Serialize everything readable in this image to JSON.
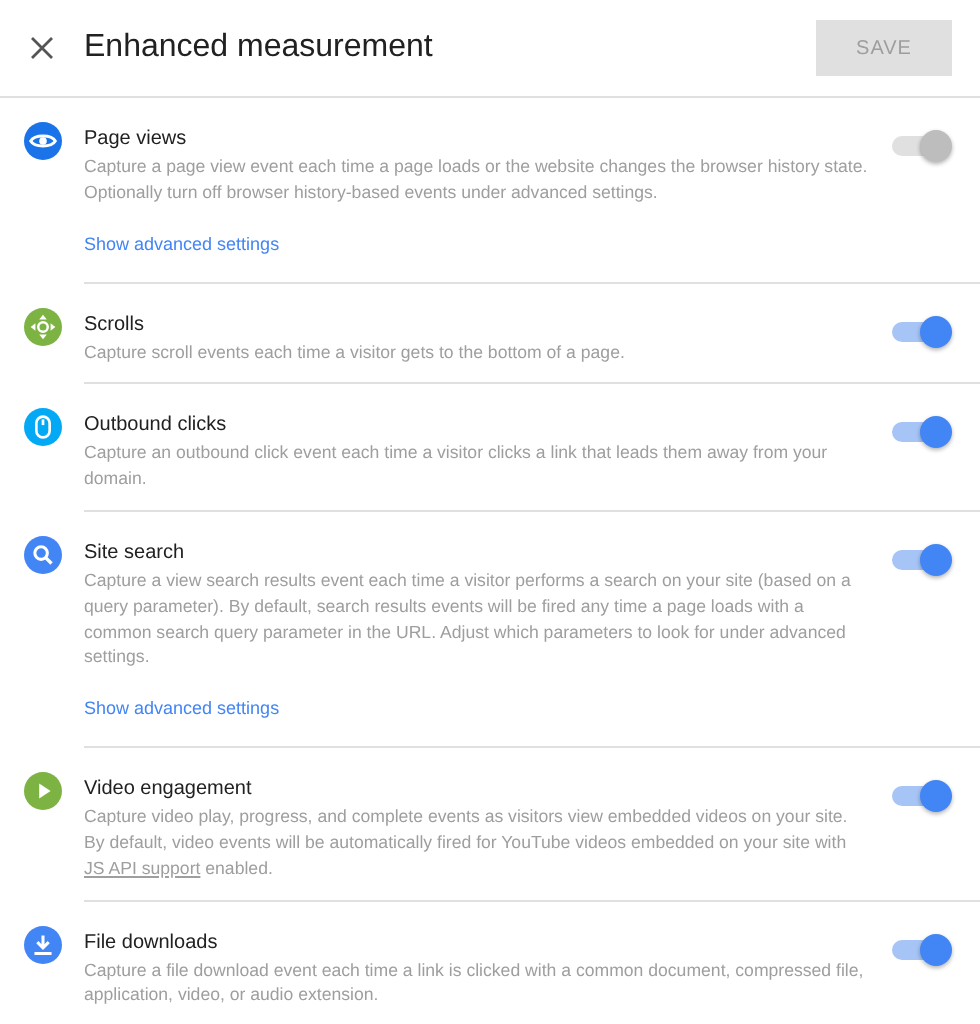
{
  "header": {
    "title": "Enhanced measurement",
    "save": {
      "label": "SAVE",
      "disabled": true
    }
  },
  "items": [
    {
      "kind": "eye",
      "color": "#1a73e8",
      "title": "Page views",
      "on": false,
      "description": [
        {
          "kind": "text",
          "text": "Capture a page view event each time a page loads or the website changes the browser history state. Optionally turn off browser history-based events under advanced settings."
        }
      ],
      "link": "Show advanced settings"
    },
    {
      "kind": "move",
      "color": "#7cb342",
      "title": "Scrolls",
      "on": true,
      "description": [
        {
          "kind": "text",
          "text": "Capture scroll events each time a visitor gets to the bottom of a page."
        }
      ]
    },
    {
      "kind": "mouse",
      "color": "#03a9f4",
      "title": "Outbound clicks",
      "on": true,
      "description": [
        {
          "kind": "text",
          "text": "Capture an outbound click event each time a visitor clicks a link that leads them away from your domain."
        }
      ]
    },
    {
      "kind": "search",
      "color": "#4285f4",
      "title": "Site search",
      "on": true,
      "description": [
        {
          "kind": "text",
          "text": "Capture a view search results event each time a visitor performs a search on your site (based on a query parameter). By default, search results events will be fired any time a page loads with a common search query parameter in the URL. Adjust which parameters to look for under advanced settings."
        }
      ],
      "link": "Show advanced settings"
    },
    {
      "kind": "play",
      "color": "#7cb342",
      "title": "Video engagement",
      "on": true,
      "description": [
        {
          "kind": "text",
          "text": "Capture video play, progress, and complete events as visitors view embedded videos on your site. By default, video events will be automatically fired for YouTube videos embedded on your site with "
        },
        {
          "kind": "link",
          "text": "JS API support"
        },
        {
          "kind": "text",
          "text": " enabled."
        }
      ]
    },
    {
      "kind": "download",
      "color": "#4285f4",
      "title": "File downloads",
      "on": true,
      "description": [
        {
          "kind": "text",
          "text": "Capture a file download event each time a link is clicked with a common document, compressed file, application, video, or audio extension."
        }
      ]
    }
  ]
}
